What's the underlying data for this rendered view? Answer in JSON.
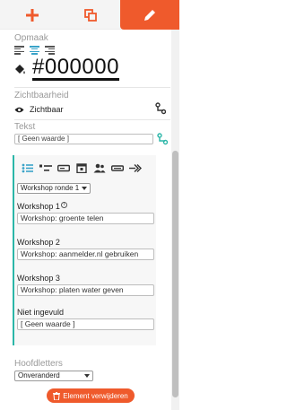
{
  "colors": {
    "accent": "#ef5a2c",
    "link": "#3aa3c8",
    "card_border": "#2bb6a8"
  },
  "topbar": {
    "tabs": [
      {
        "icon": "plus-icon"
      },
      {
        "icon": "copy-icon"
      },
      {
        "icon": "pencil-icon",
        "active": true
      }
    ]
  },
  "opmaak": {
    "label": "Opmaak",
    "align": [
      "align-left-icon",
      "align-center-icon",
      "align-right-icon"
    ],
    "align_active": "align-center-icon",
    "color_value": "#000000"
  },
  "zichtbaarheid": {
    "label": "Zichtbaarheid",
    "value": "Zichtbaar"
  },
  "tekst": {
    "label": "Tekst",
    "value": "[ Geen waarde ]"
  },
  "workshop_card": {
    "tools": [
      "list-icon",
      "list-minus-icon",
      "input-icon",
      "calendar-icon",
      "users-icon",
      "minus-field-icon",
      "arrows-right-icon"
    ],
    "select_value": "Workshop ronde 1",
    "items": [
      {
        "label": "Workshop 1",
        "value": "Workshop: groente telen",
        "has_info": true
      },
      {
        "label": "Workshop 2",
        "value": "Workshop: aanmelder.nl gebruiken",
        "has_info": false
      },
      {
        "label": "Workshop 3",
        "value": "Workshop: platen water geven",
        "has_info": false
      },
      {
        "label": "Niet ingevuld",
        "value": "[ Geen waarde ]",
        "has_info": false
      }
    ]
  },
  "hoofdletters": {
    "label": "Hoofdletters",
    "value": "Onveranderd"
  },
  "delete_button": {
    "label": "Element verwijderen"
  }
}
